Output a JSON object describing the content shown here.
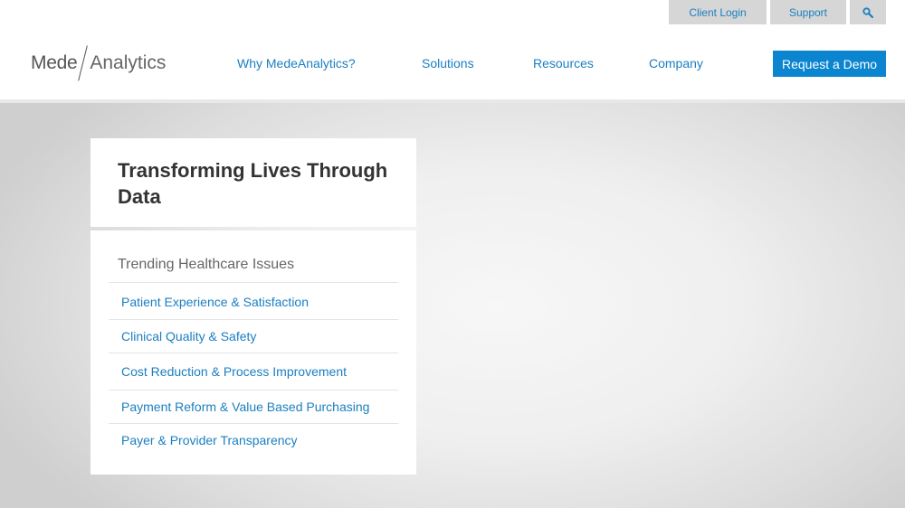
{
  "utility": {
    "client_login": "Client Login",
    "support": "Support",
    "search_icon": "search-icon"
  },
  "logo": {
    "part1": "Mede",
    "part2": "Analytics"
  },
  "nav": {
    "items": [
      "Why MedeAnalytics?",
      "Solutions",
      "Resources",
      "Company"
    ],
    "cta": "Request a Demo"
  },
  "hero": {
    "title": "Transforming Lives Through Data",
    "issues_heading": "Trending Healthcare Issues",
    "issues": [
      "Patient Experience & Satisfaction",
      "Clinical Quality & Safety",
      "Cost Reduction & Process Improvement",
      "Payment Reform & Value Based Purchasing",
      "Payer & Provider Transparency"
    ]
  },
  "colors": {
    "link": "#1a7fc1",
    "cta_bg": "#0b85cf",
    "utility_bg": "#d6d6d6"
  }
}
